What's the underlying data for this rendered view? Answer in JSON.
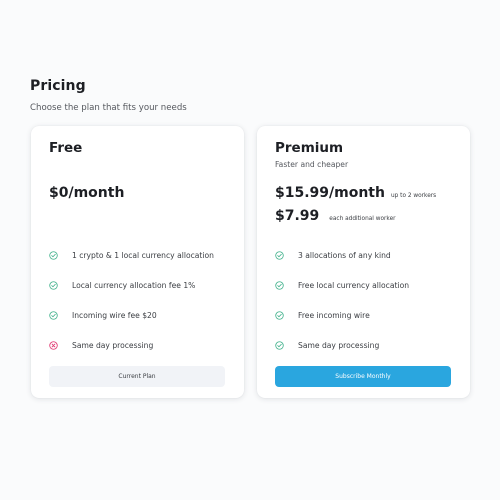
{
  "header": {
    "title": "Pricing",
    "subtitle": "Choose the plan that fits your needs"
  },
  "colors": {
    "check": "#3fb08a",
    "cross": "#e0336e",
    "primary_button": "#2aa6df",
    "secondary_button": "#f1f3f7"
  },
  "plans": [
    {
      "name": "Free",
      "price": "$0/month",
      "features": [
        {
          "label": "1 crypto & 1 local currency allocation",
          "included": true,
          "icon": "check-circle-icon"
        },
        {
          "label": "Local currency allocation fee 1%",
          "included": true,
          "icon": "check-circle-icon"
        },
        {
          "label": "Incoming wire fee $20",
          "included": true,
          "icon": "check-circle-icon"
        },
        {
          "label": "Same day processing",
          "included": false,
          "icon": "x-circle-icon"
        }
      ],
      "button_label": "Current Plan"
    },
    {
      "name": "Premium",
      "tagline": "Faster and cheaper",
      "price": "$15.99/month",
      "price_note": "up to 2 workers",
      "extra_price": "$7.99",
      "extra_price_note": "each additional worker",
      "features": [
        {
          "label": "3 allocations of any kind",
          "included": true,
          "icon": "check-circle-icon"
        },
        {
          "label": "Free local currency allocation",
          "included": true,
          "icon": "check-circle-icon"
        },
        {
          "label": "Free incoming wire",
          "included": true,
          "icon": "check-circle-icon"
        },
        {
          "label": "Same day processing",
          "included": true,
          "icon": "check-circle-icon"
        }
      ],
      "button_label": "Subscribe Monthly"
    }
  ]
}
